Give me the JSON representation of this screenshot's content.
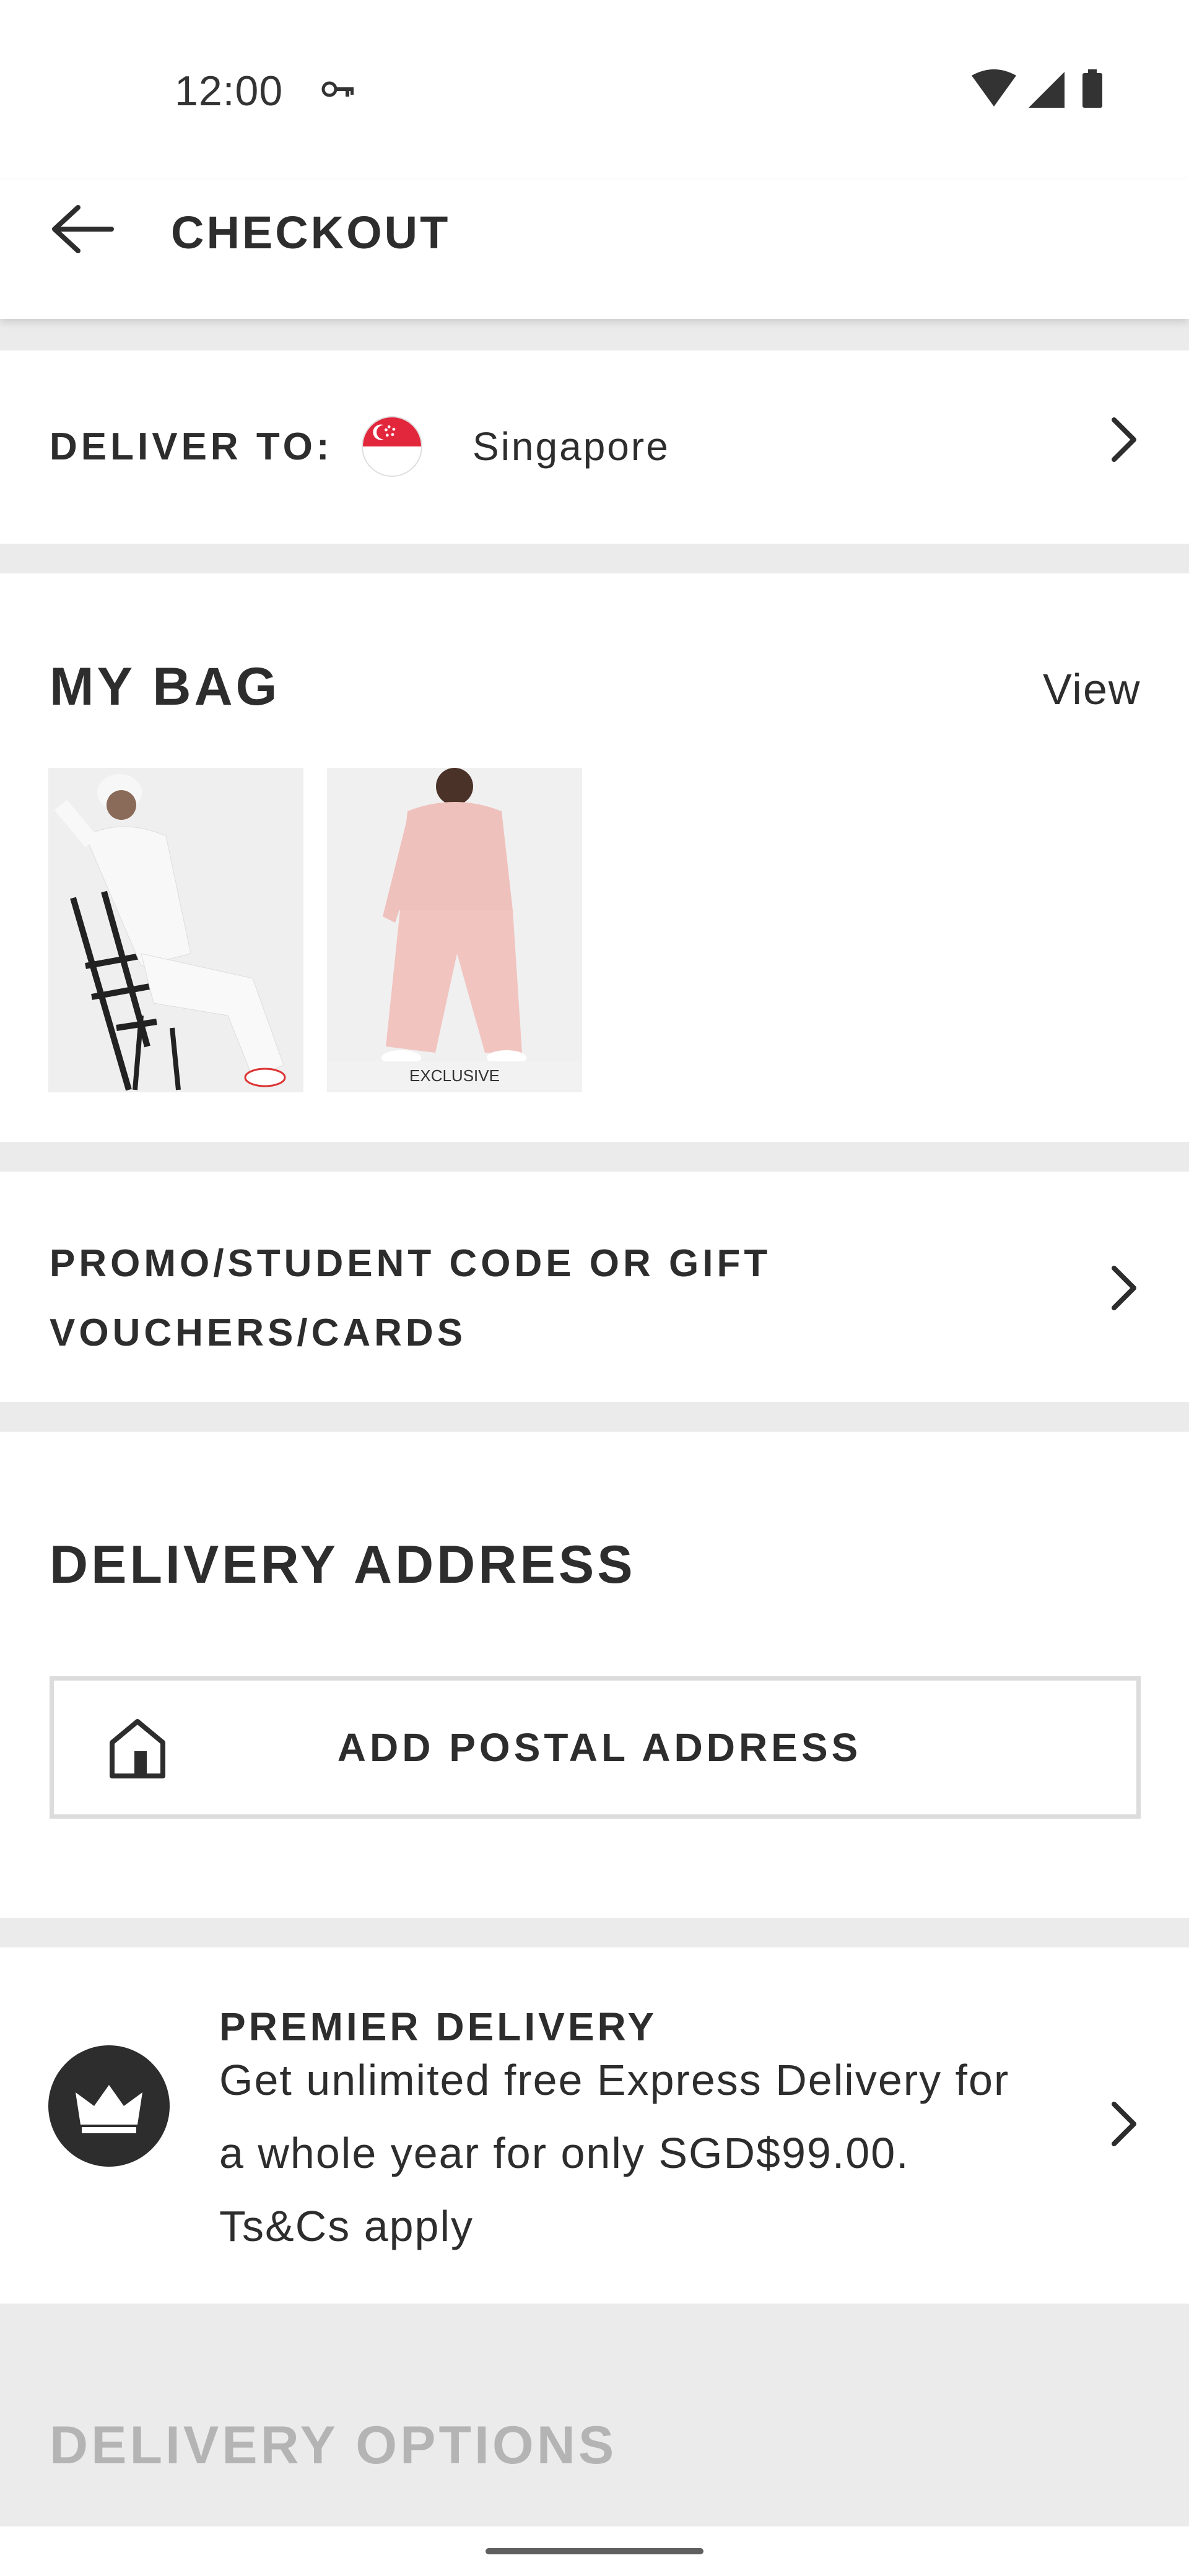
{
  "status_bar": {
    "time": "12:00"
  },
  "header": {
    "title": "CHECKOUT"
  },
  "deliver_to": {
    "label": "DELIVER TO:",
    "country": "Singapore"
  },
  "bag": {
    "title": "MY BAG",
    "view_label": "View",
    "items": [
      {
        "name": "white sweatsuit"
      },
      {
        "name": "pink sweatsuit",
        "badge": "EXCLUSIVE"
      }
    ]
  },
  "promo": {
    "label": "PROMO/STUDENT CODE OR GIFT VOUCHERS/CARDS"
  },
  "delivery_address": {
    "title": "DELIVERY ADDRESS",
    "add_button_label": "ADD POSTAL ADDRESS"
  },
  "premier": {
    "title": "PREMIER DELIVERY",
    "description": "Get unlimited free Express Delivery for a whole year for only SGD$99.00. Ts&Cs apply"
  },
  "delivery_options": {
    "title": "DELIVERY OPTIONS"
  },
  "colors": {
    "text": "#2d2d2d",
    "divider": "#ebebeb",
    "flag_red": "#e2263b",
    "muted_title": "#b4b4b4"
  }
}
